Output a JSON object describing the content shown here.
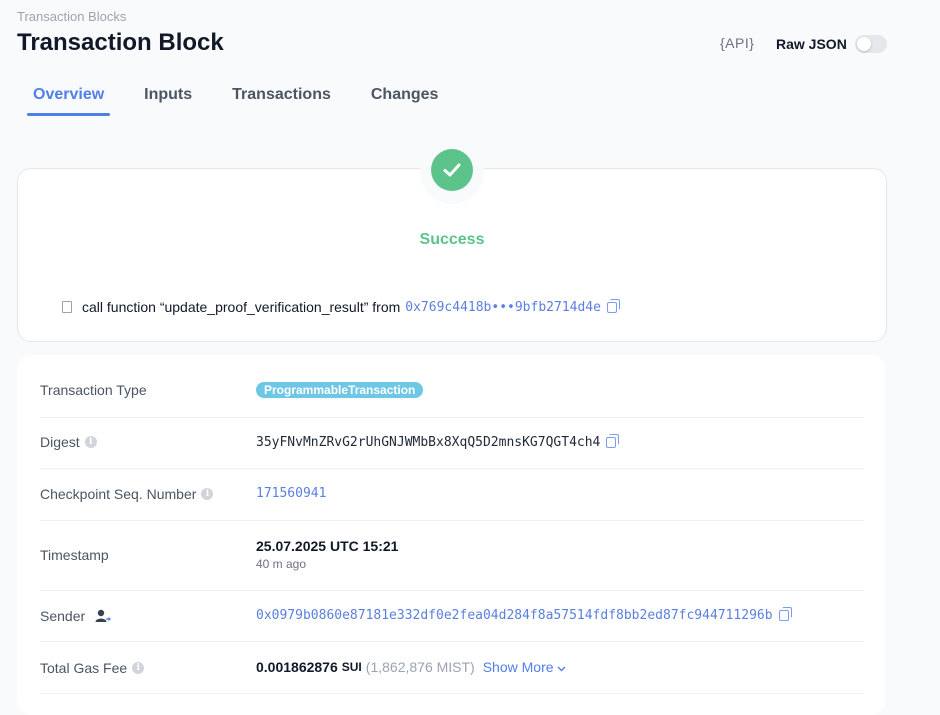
{
  "breadcrumb": "Transaction Blocks",
  "title": "Transaction Block",
  "header": {
    "api_label": "{API}",
    "raw_json_label": "Raw JSON",
    "raw_json_on": false
  },
  "tabs": [
    {
      "label": "Overview",
      "active": true
    },
    {
      "label": "Inputs",
      "active": false
    },
    {
      "label": "Transactions",
      "active": false
    },
    {
      "label": "Changes",
      "active": false
    }
  ],
  "status": {
    "label": "Success",
    "call_text": "call function “update_proof_verification_result” from",
    "call_address": "0x769c4418b•••9bfb2714d4e"
  },
  "details": {
    "type_label": "Transaction Type",
    "type_value": "ProgrammableTransaction",
    "digest_label": "Digest",
    "digest_value": "35yFNvMnZRvG2rUhGNJWMbBx8XqQ5D2mnsKG7QGT4ch4",
    "checkpoint_label": "Checkpoint Seq. Number",
    "checkpoint_value": "171560941",
    "timestamp_label": "Timestamp",
    "timestamp_value": "25.07.2025 UTC 15:21",
    "timestamp_relative": "40 m ago",
    "sender_label": "Sender",
    "sender_value": "0x0979b0860e87181e332df0e2fea04d284f8a57514fdf8bb2ed87fc944711296b",
    "gas_label": "Total Gas Fee",
    "gas_value": "0.001862876",
    "gas_unit": "SUI",
    "gas_mist": "(1,862,876 MIST)",
    "show_more": "Show More"
  },
  "colors": {
    "accent": "#4f7fe8",
    "success": "#5cc48a",
    "pill": "#6fc7e6"
  }
}
